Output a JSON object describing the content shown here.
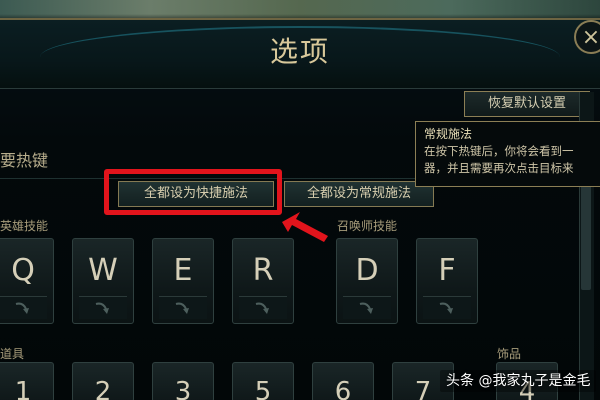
{
  "window": {
    "title": "选项",
    "close_label": "×"
  },
  "toolbar": {
    "restore_defaults_label": "恢复默认设置"
  },
  "section": {
    "title": "要热键"
  },
  "mode_buttons": {
    "quick_cast_all": "全都设为快捷施法",
    "normal_cast_all": "全都设为常规施法"
  },
  "tooltip": {
    "title": "常规施法",
    "line1": "在按下热键后，你将会看到一",
    "line2": "器，并且需要再次点击目标来"
  },
  "groups": {
    "hero_skills": "英雄技能",
    "summoner_skills": "召唤师技能",
    "items_left": "道具",
    "items_right": "饰品"
  },
  "keys": {
    "hero": [
      "Q",
      "W",
      "E",
      "R"
    ],
    "summoner": [
      "D",
      "F"
    ],
    "items": [
      "1",
      "2",
      "3",
      "5",
      "6",
      "7",
      "4"
    ]
  },
  "watermark": {
    "text": "头条 @我家丸子是金毛"
  },
  "colors": {
    "highlight_red": "#e2141c",
    "gold_border": "#8c7f55",
    "text_gold": "#d8c89a"
  }
}
